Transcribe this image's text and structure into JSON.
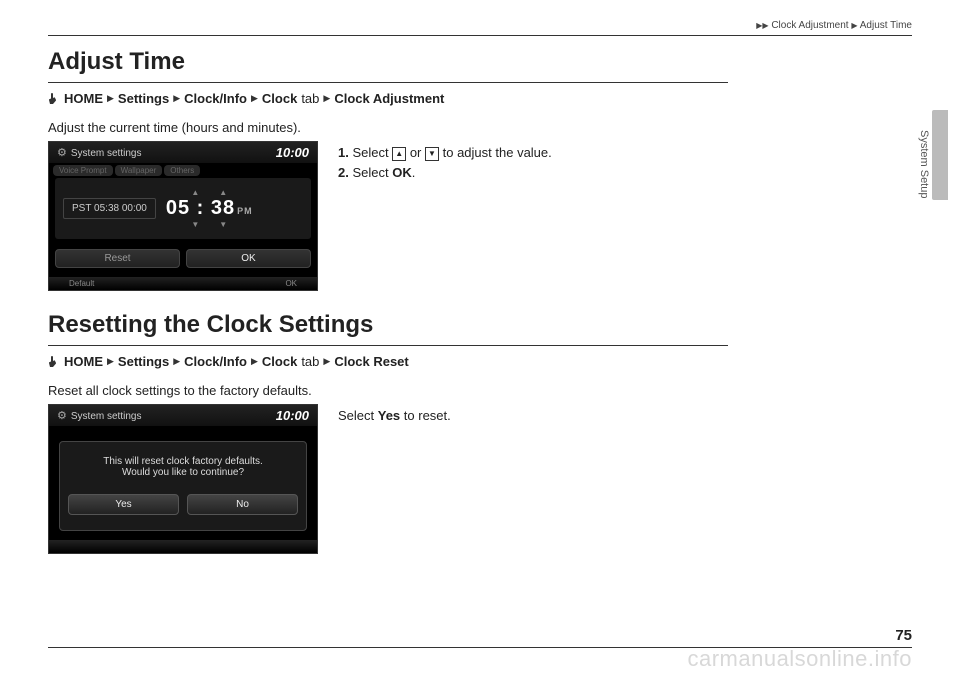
{
  "breadcrumb": {
    "sep": "▶",
    "item1": "Clock Adjustment",
    "item2": "Adjust Time"
  },
  "section1": {
    "title": "Adjust Time",
    "nav": {
      "home": "HOME",
      "settings": "Settings",
      "clockinfo": "Clock/Info",
      "clock": "Clock",
      "tab_word": "tab",
      "last": "Clock Adjustment"
    },
    "desc": "Adjust the current time (hours and minutes).",
    "screenshot": {
      "header_label": "System settings",
      "header_clock": "10:00",
      "tab1": "Voice Prompt",
      "tab2": "Wallpaper",
      "tab3": "Others",
      "pst": "PST 05:38   00:00",
      "time": "05 : 38",
      "pm": "PM",
      "reset": "Reset",
      "ok": "OK",
      "footer_left": "Default",
      "footer_right": "OK"
    },
    "steps": {
      "s1_pre": "Select ",
      "s1_or": " or ",
      "s1_post": " to adjust the value.",
      "s2_pre": "Select ",
      "s2_ok": "OK",
      "s2_post": "."
    }
  },
  "section2": {
    "title": "Resetting the Clock Settings",
    "nav": {
      "home": "HOME",
      "settings": "Settings",
      "clockinfo": "Clock/Info",
      "clock": "Clock",
      "tab_word": "tab",
      "last": "Clock Reset"
    },
    "desc": "Reset all clock settings to the factory defaults.",
    "screenshot": {
      "header_label": "System settings",
      "header_clock": "10:00",
      "dialog_line1": "This will reset clock factory defaults.",
      "dialog_line2": "Would you like to continue?",
      "yes": "Yes",
      "no": "No"
    },
    "step_pre": "Select ",
    "step_yes": "Yes",
    "step_post": " to reset."
  },
  "side_label": "System Setup",
  "page_number": "75",
  "watermark": "carmanualsonline.info"
}
